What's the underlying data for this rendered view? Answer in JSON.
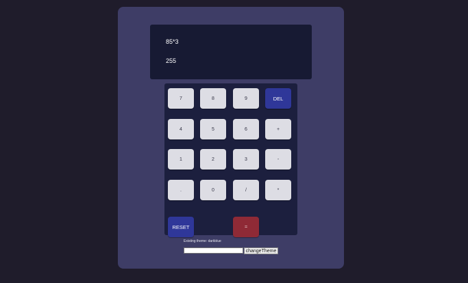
{
  "display": {
    "expression": "85*3",
    "result": "255"
  },
  "keys": {
    "seven": "7",
    "eight": "8",
    "nine": "9",
    "del": "DEL",
    "four": "4",
    "five": "5",
    "six": "6",
    "plus": "+",
    "one": "1",
    "two": "2",
    "three": "3",
    "minus": "-",
    "dot": ".",
    "zero": "0",
    "divide": "/",
    "multiply": "*",
    "reset": "RESET",
    "equals": "="
  },
  "theme": {
    "existing_text": "Existing theme: darkblue",
    "input_value": "",
    "button_label": "changeTheme"
  },
  "colors": {
    "page_background": "#1f1c2b",
    "card_background": "#3e3d66",
    "display_background": "#171a33",
    "keypad_background": "#1c1f3e",
    "key_background": "#dddde4",
    "accent_blue": "#2f3799",
    "accent_red": "#8f2a36"
  }
}
